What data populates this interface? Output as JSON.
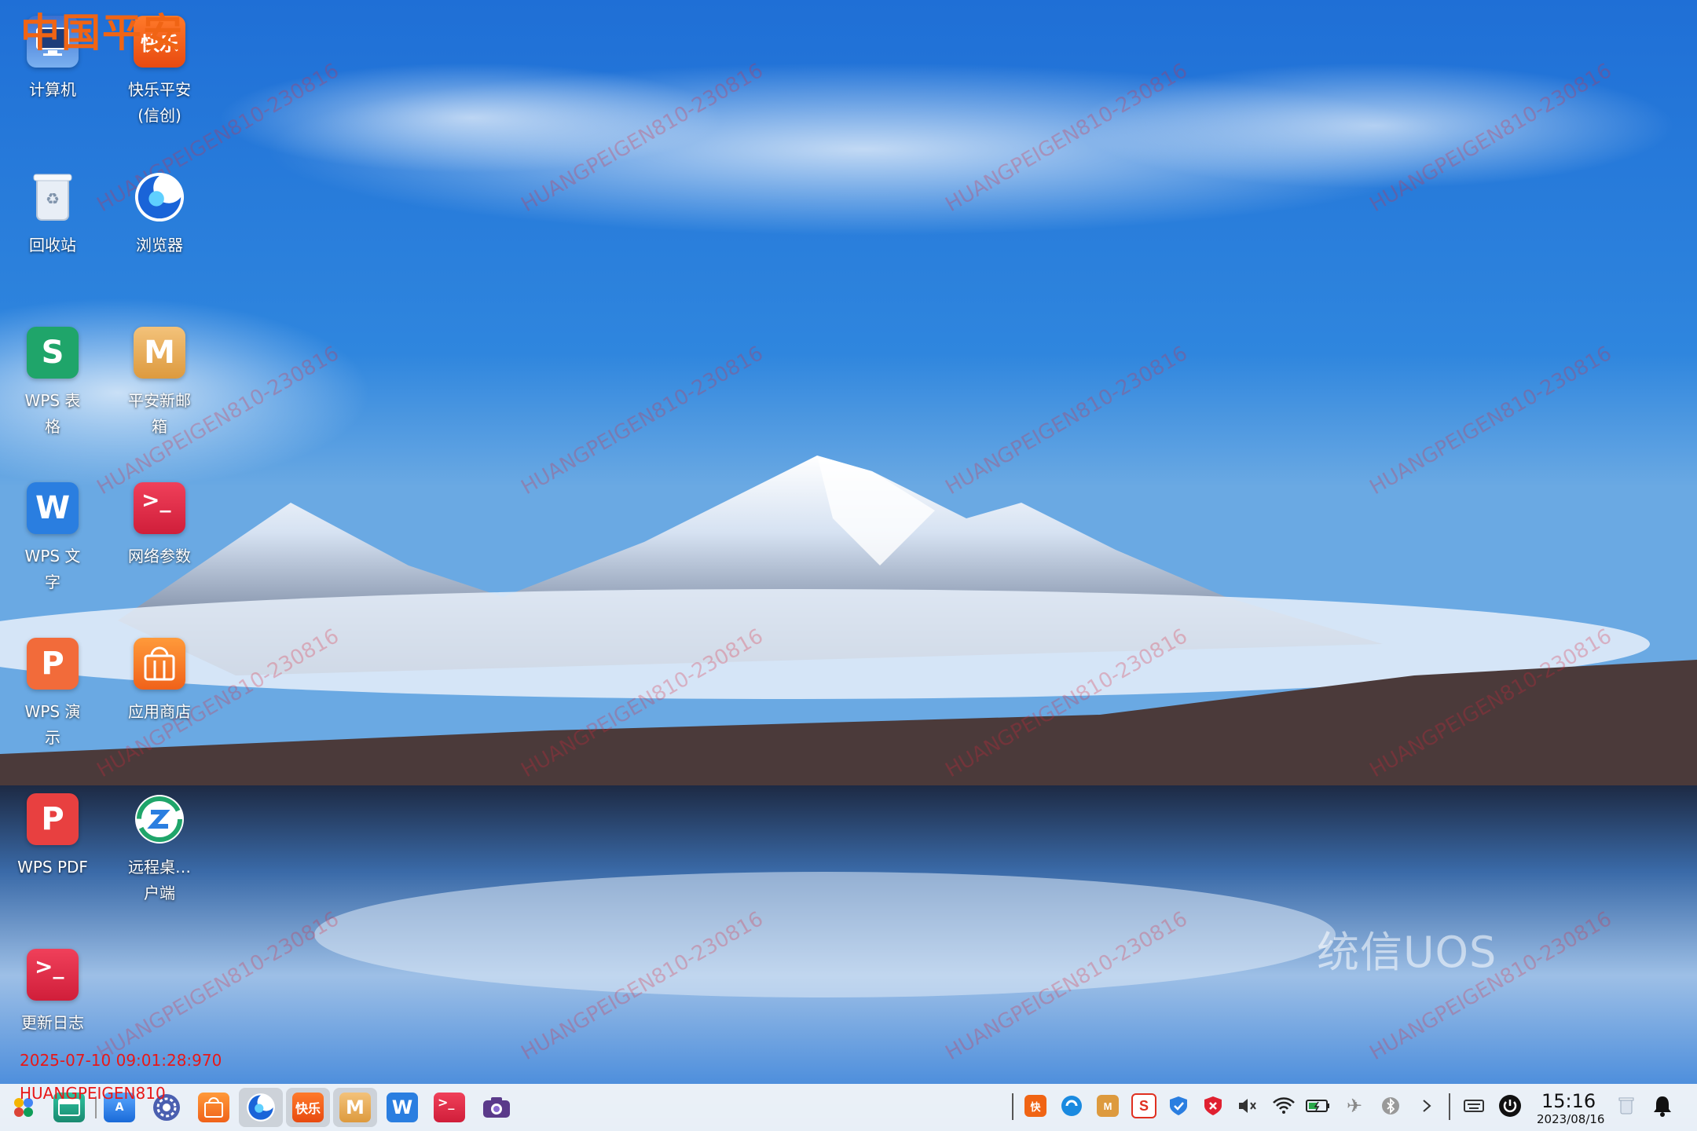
{
  "brand": {
    "logo_text": "中国平安"
  },
  "desktop": {
    "icons": [
      {
        "label": "计算机",
        "icon": "computer-icon"
      },
      {
        "label": "快乐平安(信创)",
        "icon": "kuaile-pingan-icon",
        "tile_text": "快乐"
      },
      {
        "label": "回收站",
        "icon": "trash-icon"
      },
      {
        "label": "浏览器",
        "icon": "browser-icon"
      },
      {
        "label": "WPS 表格",
        "icon": "wps-spreadsheet-icon",
        "tile_text": "S"
      },
      {
        "label": "平安新邮箱",
        "icon": "mail-icon",
        "tile_text": "M"
      },
      {
        "label": "WPS 文字",
        "icon": "wps-writer-icon",
        "tile_text": "W"
      },
      {
        "label": "网络参数",
        "icon": "terminal-icon",
        "tile_text": ">_"
      },
      {
        "label": "WPS 演示",
        "icon": "wps-presentation-icon",
        "tile_text": "P"
      },
      {
        "label": "应用商店",
        "icon": "app-store-icon"
      },
      {
        "label": "WPS PDF",
        "icon": "wps-pdf-icon",
        "tile_text": "P"
      },
      {
        "label": "远程桌…户端",
        "icon": "remote-desktop-icon"
      },
      {
        "label": "更新日志",
        "icon": "terminal-icon",
        "tile_text": ">_"
      }
    ],
    "watermark_text": "HUANGPEIGEN810-230816",
    "os_logo": "统信UOS"
  },
  "overlay": {
    "timestamp": "2025-07-10 09:01:28:970",
    "username": "HUANGPEIGEN810"
  },
  "taskbar": {
    "apps": [
      {
        "name": "launcher",
        "icon": "launcher-icon"
      },
      {
        "name": "desktop",
        "icon": "show-desktop-icon"
      },
      {
        "name": "file-manager",
        "icon": "file-manager-icon"
      },
      {
        "name": "settings",
        "icon": "settings-icon"
      },
      {
        "name": "app-store",
        "icon": "app-store-icon"
      },
      {
        "name": "browser",
        "icon": "browser-icon"
      },
      {
        "name": "kuaile-pingan",
        "icon": "kuaile-pingan-icon",
        "tile_text": "快乐"
      },
      {
        "name": "mail",
        "icon": "mail-icon",
        "tile_text": "M"
      },
      {
        "name": "wps-writer",
        "icon": "wps-writer-icon",
        "tile_text": "W"
      },
      {
        "name": "terminal",
        "icon": "terminal-icon",
        "tile_text": ">_"
      },
      {
        "name": "camera",
        "icon": "camera-icon"
      }
    ],
    "clock": {
      "time": "15:16",
      "date": "2023/08/16"
    }
  },
  "colors": {
    "accent_orange": "#f06414",
    "wps_red": "#e84040",
    "wps_green": "#1fa56a",
    "wps_blue": "#2a7ee0"
  }
}
